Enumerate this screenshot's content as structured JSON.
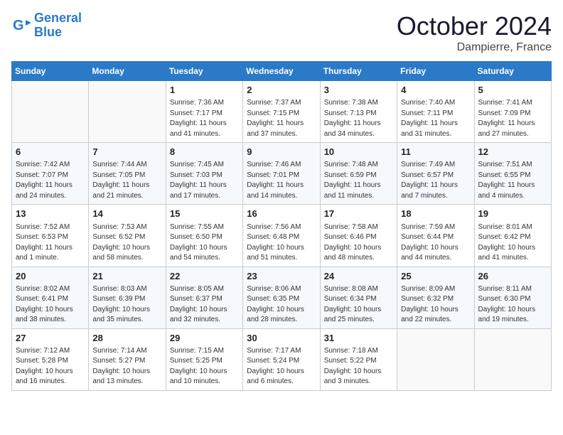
{
  "header": {
    "logo_line1": "General",
    "logo_line2": "Blue",
    "month_title": "October 2024",
    "subtitle": "Dampierre, France"
  },
  "days_of_week": [
    "Sunday",
    "Monday",
    "Tuesday",
    "Wednesday",
    "Thursday",
    "Friday",
    "Saturday"
  ],
  "weeks": [
    [
      {
        "day": "",
        "info": ""
      },
      {
        "day": "",
        "info": ""
      },
      {
        "day": "1",
        "info": "Sunrise: 7:36 AM\nSunset: 7:17 PM\nDaylight: 11 hours and 41 minutes."
      },
      {
        "day": "2",
        "info": "Sunrise: 7:37 AM\nSunset: 7:15 PM\nDaylight: 11 hours and 37 minutes."
      },
      {
        "day": "3",
        "info": "Sunrise: 7:38 AM\nSunset: 7:13 PM\nDaylight: 11 hours and 34 minutes."
      },
      {
        "day": "4",
        "info": "Sunrise: 7:40 AM\nSunset: 7:11 PM\nDaylight: 11 hours and 31 minutes."
      },
      {
        "day": "5",
        "info": "Sunrise: 7:41 AM\nSunset: 7:09 PM\nDaylight: 11 hours and 27 minutes."
      }
    ],
    [
      {
        "day": "6",
        "info": "Sunrise: 7:42 AM\nSunset: 7:07 PM\nDaylight: 11 hours and 24 minutes."
      },
      {
        "day": "7",
        "info": "Sunrise: 7:44 AM\nSunset: 7:05 PM\nDaylight: 11 hours and 21 minutes."
      },
      {
        "day": "8",
        "info": "Sunrise: 7:45 AM\nSunset: 7:03 PM\nDaylight: 11 hours and 17 minutes."
      },
      {
        "day": "9",
        "info": "Sunrise: 7:46 AM\nSunset: 7:01 PM\nDaylight: 11 hours and 14 minutes."
      },
      {
        "day": "10",
        "info": "Sunrise: 7:48 AM\nSunset: 6:59 PM\nDaylight: 11 hours and 11 minutes."
      },
      {
        "day": "11",
        "info": "Sunrise: 7:49 AM\nSunset: 6:57 PM\nDaylight: 11 hours and 7 minutes."
      },
      {
        "day": "12",
        "info": "Sunrise: 7:51 AM\nSunset: 6:55 PM\nDaylight: 11 hours and 4 minutes."
      }
    ],
    [
      {
        "day": "13",
        "info": "Sunrise: 7:52 AM\nSunset: 6:53 PM\nDaylight: 11 hours and 1 minute."
      },
      {
        "day": "14",
        "info": "Sunrise: 7:53 AM\nSunset: 6:52 PM\nDaylight: 10 hours and 58 minutes."
      },
      {
        "day": "15",
        "info": "Sunrise: 7:55 AM\nSunset: 6:50 PM\nDaylight: 10 hours and 54 minutes."
      },
      {
        "day": "16",
        "info": "Sunrise: 7:56 AM\nSunset: 6:48 PM\nDaylight: 10 hours and 51 minutes."
      },
      {
        "day": "17",
        "info": "Sunrise: 7:58 AM\nSunset: 6:46 PM\nDaylight: 10 hours and 48 minutes."
      },
      {
        "day": "18",
        "info": "Sunrise: 7:59 AM\nSunset: 6:44 PM\nDaylight: 10 hours and 44 minutes."
      },
      {
        "day": "19",
        "info": "Sunrise: 8:01 AM\nSunset: 6:42 PM\nDaylight: 10 hours and 41 minutes."
      }
    ],
    [
      {
        "day": "20",
        "info": "Sunrise: 8:02 AM\nSunset: 6:41 PM\nDaylight: 10 hours and 38 minutes."
      },
      {
        "day": "21",
        "info": "Sunrise: 8:03 AM\nSunset: 6:39 PM\nDaylight: 10 hours and 35 minutes."
      },
      {
        "day": "22",
        "info": "Sunrise: 8:05 AM\nSunset: 6:37 PM\nDaylight: 10 hours and 32 minutes."
      },
      {
        "day": "23",
        "info": "Sunrise: 8:06 AM\nSunset: 6:35 PM\nDaylight: 10 hours and 28 minutes."
      },
      {
        "day": "24",
        "info": "Sunrise: 8:08 AM\nSunset: 6:34 PM\nDaylight: 10 hours and 25 minutes."
      },
      {
        "day": "25",
        "info": "Sunrise: 8:09 AM\nSunset: 6:32 PM\nDaylight: 10 hours and 22 minutes."
      },
      {
        "day": "26",
        "info": "Sunrise: 8:11 AM\nSunset: 6:30 PM\nDaylight: 10 hours and 19 minutes."
      }
    ],
    [
      {
        "day": "27",
        "info": "Sunrise: 7:12 AM\nSunset: 5:28 PM\nDaylight: 10 hours and 16 minutes."
      },
      {
        "day": "28",
        "info": "Sunrise: 7:14 AM\nSunset: 5:27 PM\nDaylight: 10 hours and 13 minutes."
      },
      {
        "day": "29",
        "info": "Sunrise: 7:15 AM\nSunset: 5:25 PM\nDaylight: 10 hours and 10 minutes."
      },
      {
        "day": "30",
        "info": "Sunrise: 7:17 AM\nSunset: 5:24 PM\nDaylight: 10 hours and 6 minutes."
      },
      {
        "day": "31",
        "info": "Sunrise: 7:18 AM\nSunset: 5:22 PM\nDaylight: 10 hours and 3 minutes."
      },
      {
        "day": "",
        "info": ""
      },
      {
        "day": "",
        "info": ""
      }
    ]
  ]
}
